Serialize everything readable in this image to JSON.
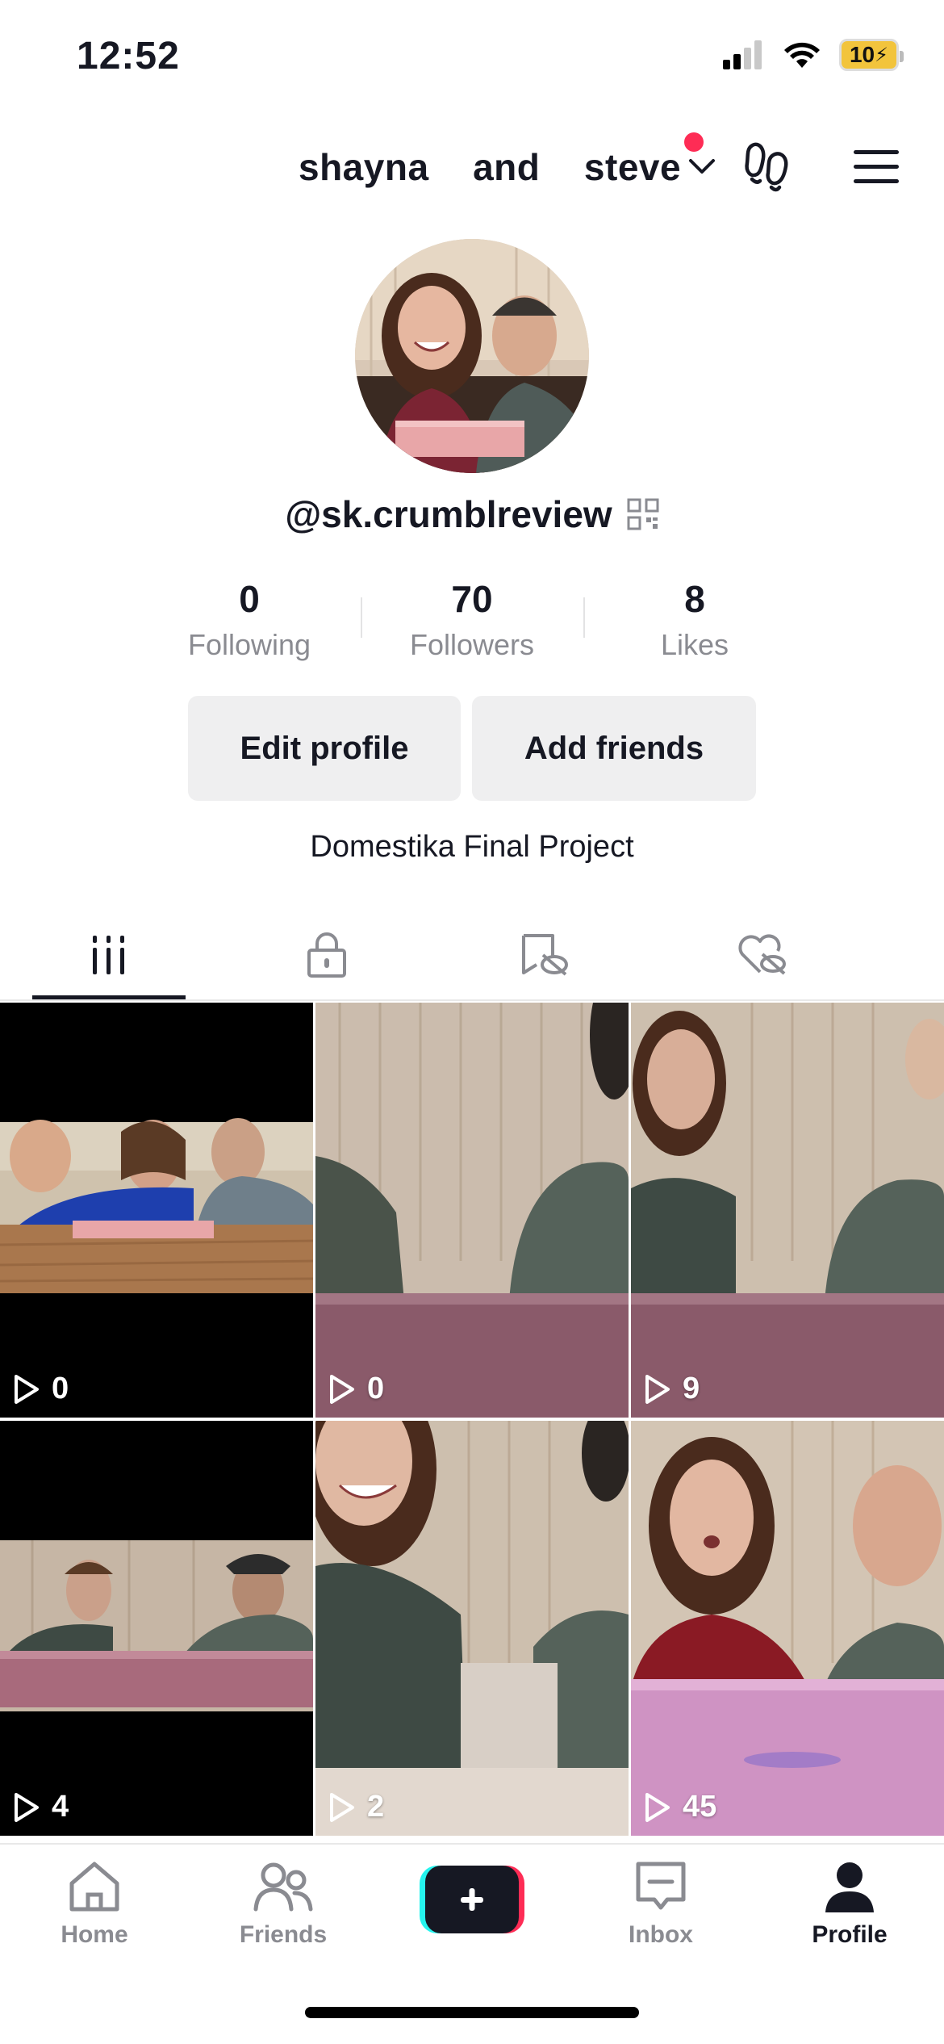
{
  "status_bar": {
    "time": "12:52",
    "battery": "10"
  },
  "header": {
    "account_name": "shayna  and  steve"
  },
  "profile": {
    "username": "@sk.crumblreview",
    "stats": [
      {
        "value": "0",
        "label": "Following"
      },
      {
        "value": "70",
        "label": "Followers"
      },
      {
        "value": "8",
        "label": "Likes"
      }
    ],
    "edit_label": "Edit profile",
    "add_friends_label": "Add friends",
    "bio": "Domestika Final Project"
  },
  "videos": [
    {
      "views": "0"
    },
    {
      "views": "0"
    },
    {
      "views": "9"
    },
    {
      "views": "4"
    },
    {
      "views": "2"
    },
    {
      "views": "45"
    }
  ],
  "nav": {
    "items": [
      {
        "label": "Home"
      },
      {
        "label": "Friends"
      },
      {
        "label": "Inbox"
      },
      {
        "label": "Profile"
      }
    ],
    "active": "Profile"
  },
  "colors": {
    "accent_red": "#fe2c55",
    "accent_cyan": "#25f4ee",
    "text": "#161823",
    "muted": "#8a8b91"
  }
}
